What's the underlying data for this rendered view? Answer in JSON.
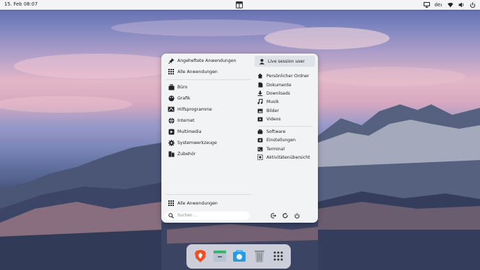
{
  "topbar": {
    "datetime": "15. Feb  08:07",
    "language": "de₁"
  },
  "menu": {
    "left_top": [
      {
        "label": "Angeheftete Anwendungen",
        "icon": "pin-icon"
      },
      {
        "label": "Alle Anwendungen",
        "icon": "grid-icon"
      }
    ],
    "categories": [
      {
        "label": "Büro",
        "icon": "briefcase-icon"
      },
      {
        "label": "Grafik",
        "icon": "palette-icon"
      },
      {
        "label": "Hilfsprogramme",
        "icon": "utilities-icon"
      },
      {
        "label": "Internet",
        "icon": "globe-icon"
      },
      {
        "label": "Multimedia",
        "icon": "multimedia-icon"
      },
      {
        "label": "Systemwerkzeuge",
        "icon": "gear-icon"
      },
      {
        "label": "Zubehör",
        "icon": "accessories-icon"
      }
    ],
    "all_apps_bottom": "Alle Anwendungen",
    "user": "Live session user",
    "places": [
      {
        "label": "Persönlicher Ordner",
        "icon": "home-icon"
      },
      {
        "label": "Dokumente",
        "icon": "document-icon"
      },
      {
        "label": "Downloads",
        "icon": "download-icon"
      },
      {
        "label": "Musik",
        "icon": "music-icon"
      },
      {
        "label": "Bilder",
        "icon": "image-icon"
      },
      {
        "label": "Videos",
        "icon": "video-icon"
      }
    ],
    "system": [
      {
        "label": "Software",
        "icon": "software-icon"
      },
      {
        "label": "Einstellungen",
        "icon": "settings-icon"
      },
      {
        "label": "Terminal",
        "icon": "terminal-icon"
      },
      {
        "label": "Aktivitätenübersicht",
        "icon": "overview-icon"
      }
    ],
    "search_placeholder": "Suchen ..."
  },
  "dock": {
    "apps": [
      "brave-browser-icon",
      "file-manager-icon",
      "software-store-icon",
      "trash-icon",
      "app-grid-icon"
    ]
  },
  "colors": {
    "menu_bg": "#f2f3f5",
    "topbar_bg": "#f4f4f6",
    "text": "#1f1f1f"
  }
}
